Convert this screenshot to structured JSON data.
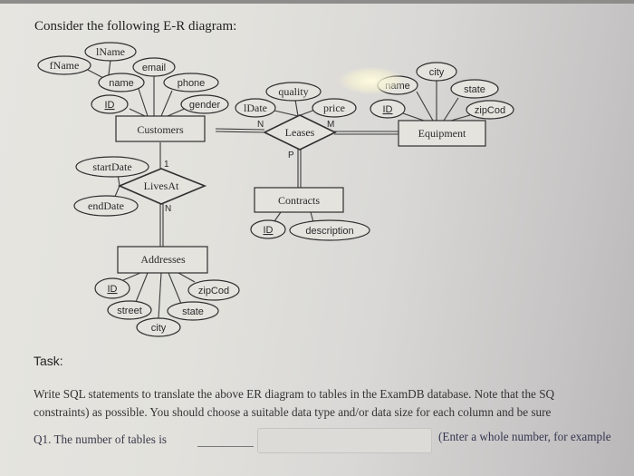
{
  "heading": "Consider the following E-R diagram:",
  "diagram": {
    "entities": {
      "customers": "Customers",
      "equipment": "Equipment",
      "contracts": "Contracts",
      "addresses": "Addresses"
    },
    "relationships": {
      "leases": "Leases",
      "livesAt": "LivesAt"
    },
    "customer_attributes": {
      "lName": "lName",
      "fName": "fName",
      "email": "email",
      "name": "name",
      "phone": "phone",
      "id": "ID",
      "gender": "gender"
    },
    "leases_attributes": {
      "lDate": "lDate",
      "quality": "quality",
      "price": "price"
    },
    "equipment_attributes": {
      "name": "name",
      "city": "city",
      "state": "state",
      "id": "ID",
      "zipCod": "zipCod"
    },
    "contracts_attributes": {
      "id": "ID",
      "description": "description"
    },
    "livesAt_attributes": {
      "startDate": "startDate",
      "endDate": "endDate"
    },
    "addresses_attributes": {
      "id": "ID",
      "zipCod": "zipCod",
      "street": "street",
      "state": "state",
      "city": "city"
    },
    "cardinalities": {
      "leases_customers": "N",
      "leases_equipment": "M",
      "leases_contracts": "P",
      "livesAt_customers": "1",
      "livesAt_addresses": "N"
    }
  },
  "task": {
    "label": "Task:",
    "line1": "Write SQL statements to translate the above ER diagram to tables in the ExamDB database.  Note that the SQ",
    "line2": "constraints) as possible.  You should choose a suitable data type and/or data size for each column and be sure",
    "q1_label": "Q1.  The number of tables is",
    "q1_value": "",
    "q1_hint": "(Enter a whole number, for example"
  }
}
